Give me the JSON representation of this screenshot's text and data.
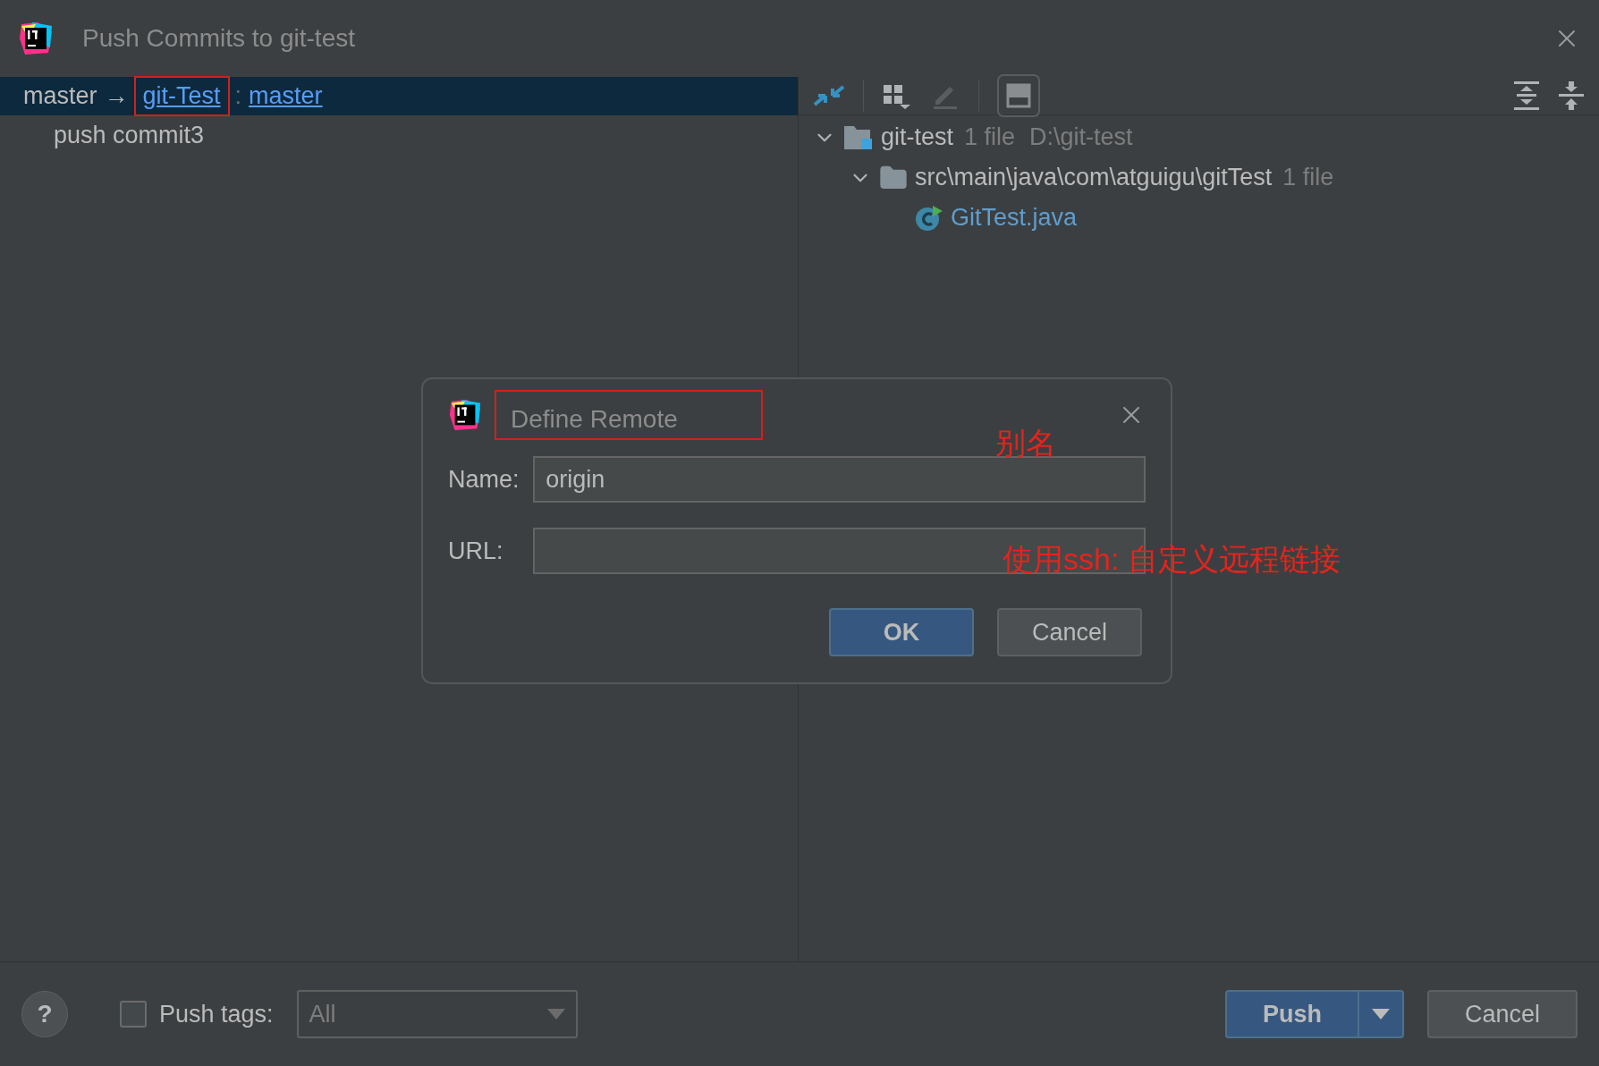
{
  "window": {
    "title": "Push Commits to git-test"
  },
  "push_targets": [
    {
      "branch": "master",
      "arrow": "→",
      "remote": "git-Test",
      "highlighted": true,
      "separator": ":",
      "remote_branch": "master",
      "selected": true,
      "commits": [
        "push commit3"
      ]
    }
  ],
  "tree": [
    {
      "kind": "repo",
      "name": "git-test",
      "count": "1 file",
      "path": "D:\\git-test",
      "expanded": true,
      "children": [
        {
          "kind": "folder",
          "name": "src\\main\\java\\com\\atguigu\\gitTest",
          "count": "1 file",
          "expanded": true,
          "children": [
            {
              "kind": "java-class",
              "name": "GitTest.java"
            }
          ]
        }
      ]
    }
  ],
  "dialog": {
    "title": "Define Remote",
    "highlighted": true,
    "fields": [
      {
        "label": "Name:",
        "value": "origin",
        "note": "别名"
      },
      {
        "label": "URL:",
        "note": "使用ssh: 自定义远程链接"
      }
    ],
    "buttons": [
      {
        "label": "OK",
        "default": true
      },
      {
        "label": "Cancel",
        "default": false
      }
    ]
  },
  "footer": {
    "help": "?",
    "push_tags": {
      "label": "Push tags:",
      "checked": false,
      "value": "All"
    },
    "buttons": [
      {
        "label": "Push",
        "default": true,
        "split": true
      },
      {
        "label": "Cancel",
        "default": false,
        "split": false
      }
    ]
  }
}
